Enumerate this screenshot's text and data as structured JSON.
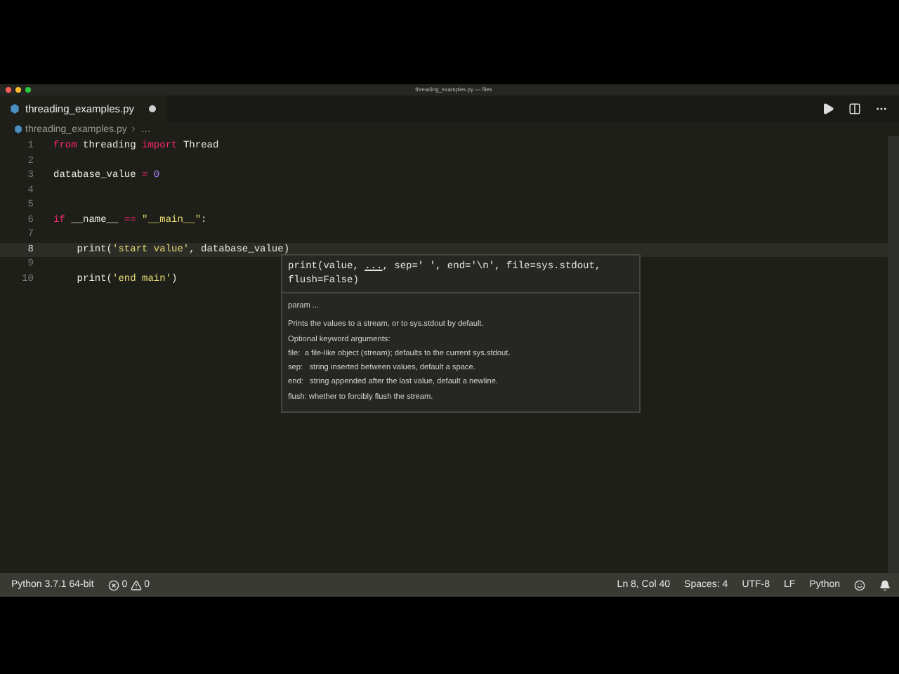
{
  "window": {
    "title": "threading_examples.py — files"
  },
  "tabs": [
    {
      "label": "threading_examples.py",
      "selected": true,
      "dirty": true
    }
  ],
  "breadcrumb": [
    "threading_examples.py",
    "…"
  ],
  "editor": {
    "lines": [
      {
        "number": "1",
        "current": false,
        "tokens": [
          {
            "kind": "keyword",
            "text": "from"
          },
          {
            "kind": "plain",
            "text": " threading "
          },
          {
            "kind": "keyword",
            "text": "import"
          },
          {
            "kind": "plain",
            "text": " Thread"
          }
        ]
      },
      {
        "number": "2",
        "current": false
      },
      {
        "number": "3",
        "current": false,
        "tokens": [
          {
            "kind": "plain",
            "text": "database_value "
          },
          {
            "kind": "keyword",
            "text": "="
          },
          {
            "kind": "number",
            "text": " 0"
          }
        ]
      },
      {
        "number": "4",
        "current": false
      },
      {
        "number": "5",
        "current": false
      },
      {
        "number": "6",
        "current": false,
        "tokens": [
          {
            "kind": "keyword",
            "text": "if"
          },
          {
            "kind": "plain",
            "text": " __name__ "
          },
          {
            "kind": "keyword",
            "text": "=="
          },
          {
            "kind": "string",
            "text": " \"__main__\""
          },
          {
            "kind": "plain",
            "text": ":"
          }
        ]
      },
      {
        "number": "7",
        "current": false
      },
      {
        "number": "8",
        "current": true,
        "tokens": [
          {
            "kind": "plain",
            "text": "    print("
          },
          {
            "kind": "string",
            "text": "'start value'"
          },
          {
            "kind": "plain",
            "text": ", database_value)"
          }
        ]
      },
      {
        "number": "9",
        "current": false
      },
      {
        "number": "10",
        "current": false,
        "tokens": [
          {
            "kind": "plain",
            "text": "    print("
          },
          {
            "kind": "string",
            "text": "'end main'"
          },
          {
            "kind": "plain",
            "text": ")"
          }
        ]
      }
    ]
  },
  "hover": {
    "signature": [
      {
        "text": "print(value, ",
        "active": false
      },
      {
        "text": "...",
        "active": true
      },
      {
        "text": ", sep=' ', end='\\n', file=sys.stdout, flush=False)",
        "active": false
      }
    ],
    "param": "param ...",
    "doc": [
      "Prints the values to a stream, or to sys.stdout by default.",
      "Optional keyword arguments:",
      "file:  a file-like object (stream); defaults to the current sys.stdout.",
      "sep:   string inserted between values, default a space.",
      "end:   string appended after the last value, default a newline.",
      "flush: whether to forcibly flush the stream."
    ]
  },
  "status_bar": {
    "interpreter": "Python 3.7.1 64-bit",
    "errors": "0",
    "warnings": "0",
    "position": "Ln 8, Col 40",
    "indent": "Spaces: 4",
    "encoding": "UTF-8",
    "eol": "LF",
    "language": "Python"
  }
}
